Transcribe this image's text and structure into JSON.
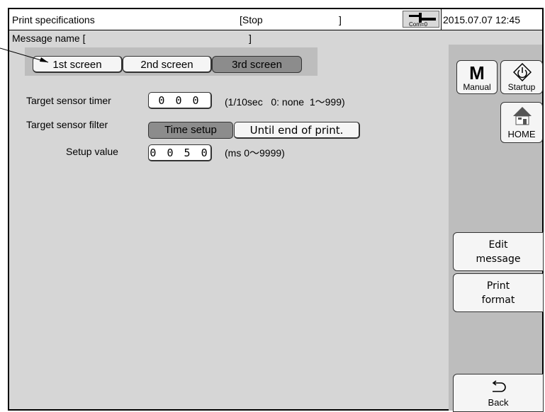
{
  "header": {
    "title": "Print specifications",
    "status": "[Stop",
    "status_close": "]",
    "com_label": "Com=0",
    "datetime": "2015.07.07 12:45"
  },
  "message_name": {
    "label": "Message name [",
    "close": "]"
  },
  "tabs": [
    {
      "label": "1st screen",
      "selected": false
    },
    {
      "label": "2nd screen",
      "selected": false
    },
    {
      "label": "3rd screen",
      "selected": true
    }
  ],
  "settings": {
    "timer": {
      "label": "Target sensor timer",
      "value": "0 0 0",
      "hint": "(1/10sec   0: none  1〜999)"
    },
    "filter": {
      "label": "Target sensor filter",
      "option_selected": "Time setup",
      "option_other": "Until end of print."
    },
    "setup": {
      "label": "Setup value",
      "value": "0 0 5 0",
      "hint": "(ms 0〜9999)"
    }
  },
  "side": {
    "manual_glyph": "M",
    "manual_label": "Manual",
    "startup_label": "Startup",
    "home_label": "HOME",
    "edit_message": [
      "Edit",
      "message"
    ],
    "print_format": [
      "Print",
      "format"
    ],
    "back_label": "Back"
  },
  "colors": {
    "panel_bg": "#d6d6d6",
    "selected_bg": "#8c8c8c",
    "button_bg": "#f5f5f5"
  },
  "icons": [
    "com-status-icon",
    "startup-icon",
    "home-icon",
    "back-arrow-icon"
  ]
}
